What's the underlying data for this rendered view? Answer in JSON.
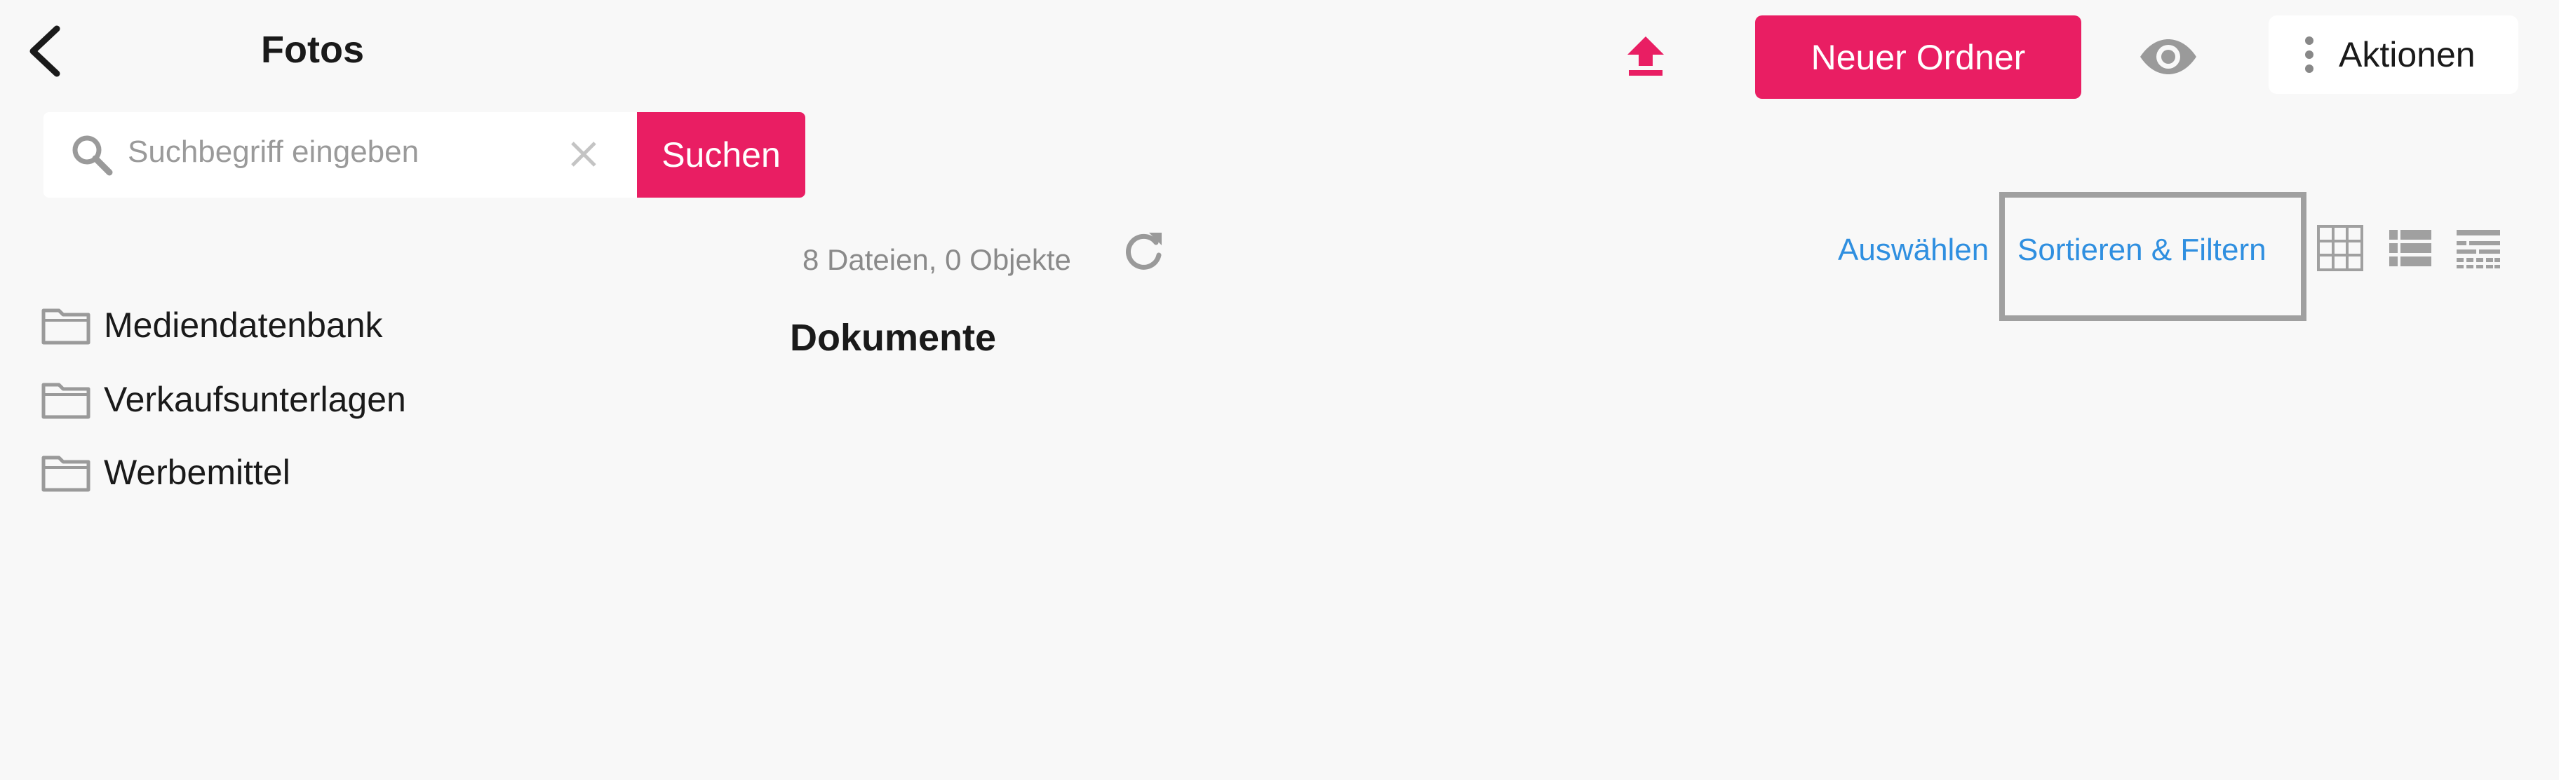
{
  "header": {
    "back_icon": "chevron-left-icon",
    "title": "Fotos",
    "upload_icon": "upload-icon",
    "new_folder_label": "Neuer Ordner",
    "preview_icon": "eye-icon",
    "actions_label": "Aktionen",
    "actions_icon": "more-vertical-icon"
  },
  "search": {
    "placeholder": "Suchbegriff eingeben",
    "value": "",
    "button_label": "Suchen",
    "search_icon": "search-icon",
    "clear_icon": "close-icon"
  },
  "sidebar": {
    "folders": [
      {
        "label": "Mediendatenbank",
        "icon": "folder-icon"
      },
      {
        "label": "Verkaufsunterlagen",
        "icon": "folder-icon"
      },
      {
        "label": "Werbemittel",
        "icon": "folder-icon"
      }
    ]
  },
  "content": {
    "file_count": "8 Dateien, 0 Objekte",
    "refresh_icon": "refresh-icon",
    "section_heading": "Dokumente",
    "select_label": "Auswählen",
    "sort_filter_label": "Sortieren & Filtern",
    "view_modes": [
      "grid-view-icon",
      "list-view-icon",
      "table-view-icon"
    ]
  },
  "colors": {
    "accent": "#e91e63",
    "link": "#2f8fe0",
    "background": "#f8f8f8",
    "icon_gray": "#9a9a9a"
  }
}
